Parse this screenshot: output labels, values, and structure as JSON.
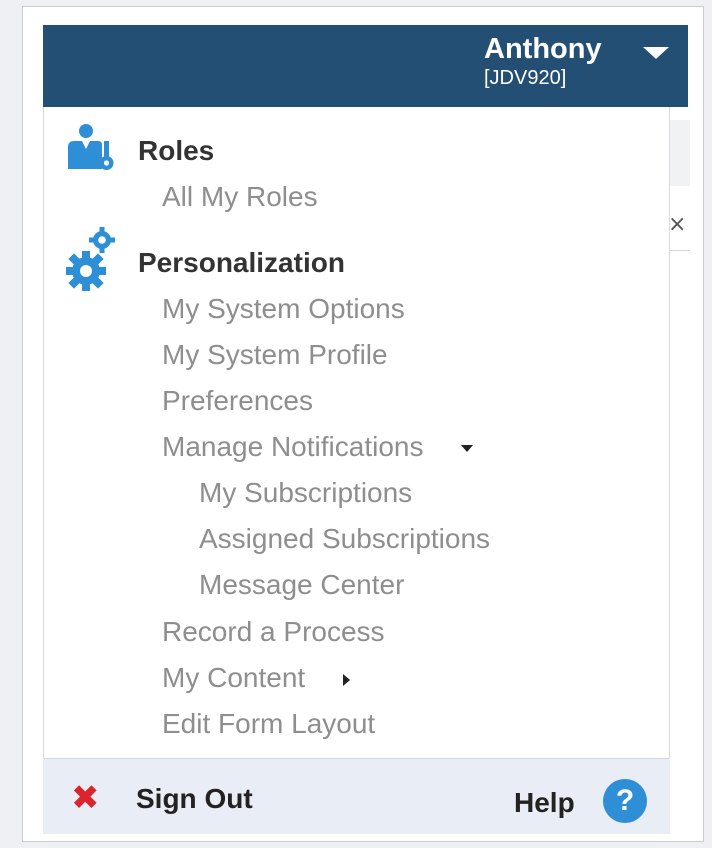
{
  "user": {
    "name": "Anthony",
    "id": "[JDV920]"
  },
  "sections": {
    "roles": {
      "title": "Roles",
      "icon": "user-key-icon",
      "items": [
        "All My Roles"
      ]
    },
    "personalization": {
      "title": "Personalization",
      "icon": "gears-icon",
      "items": [
        "My System Options",
        "My System Profile",
        "Preferences",
        "Manage Notifications",
        "My Subscriptions",
        "Assigned Subscriptions",
        "Message Center",
        "Record a Process",
        "My Content",
        "Edit Form Layout"
      ]
    }
  },
  "footer": {
    "sign_out": "Sign Out",
    "help": "Help",
    "help_icon_glyph": "?"
  },
  "colors": {
    "header_bg": "#244f74",
    "icon_blue": "#2e8fd6",
    "sign_out_red": "#d9252b",
    "footer_bg": "#e9edf5"
  }
}
